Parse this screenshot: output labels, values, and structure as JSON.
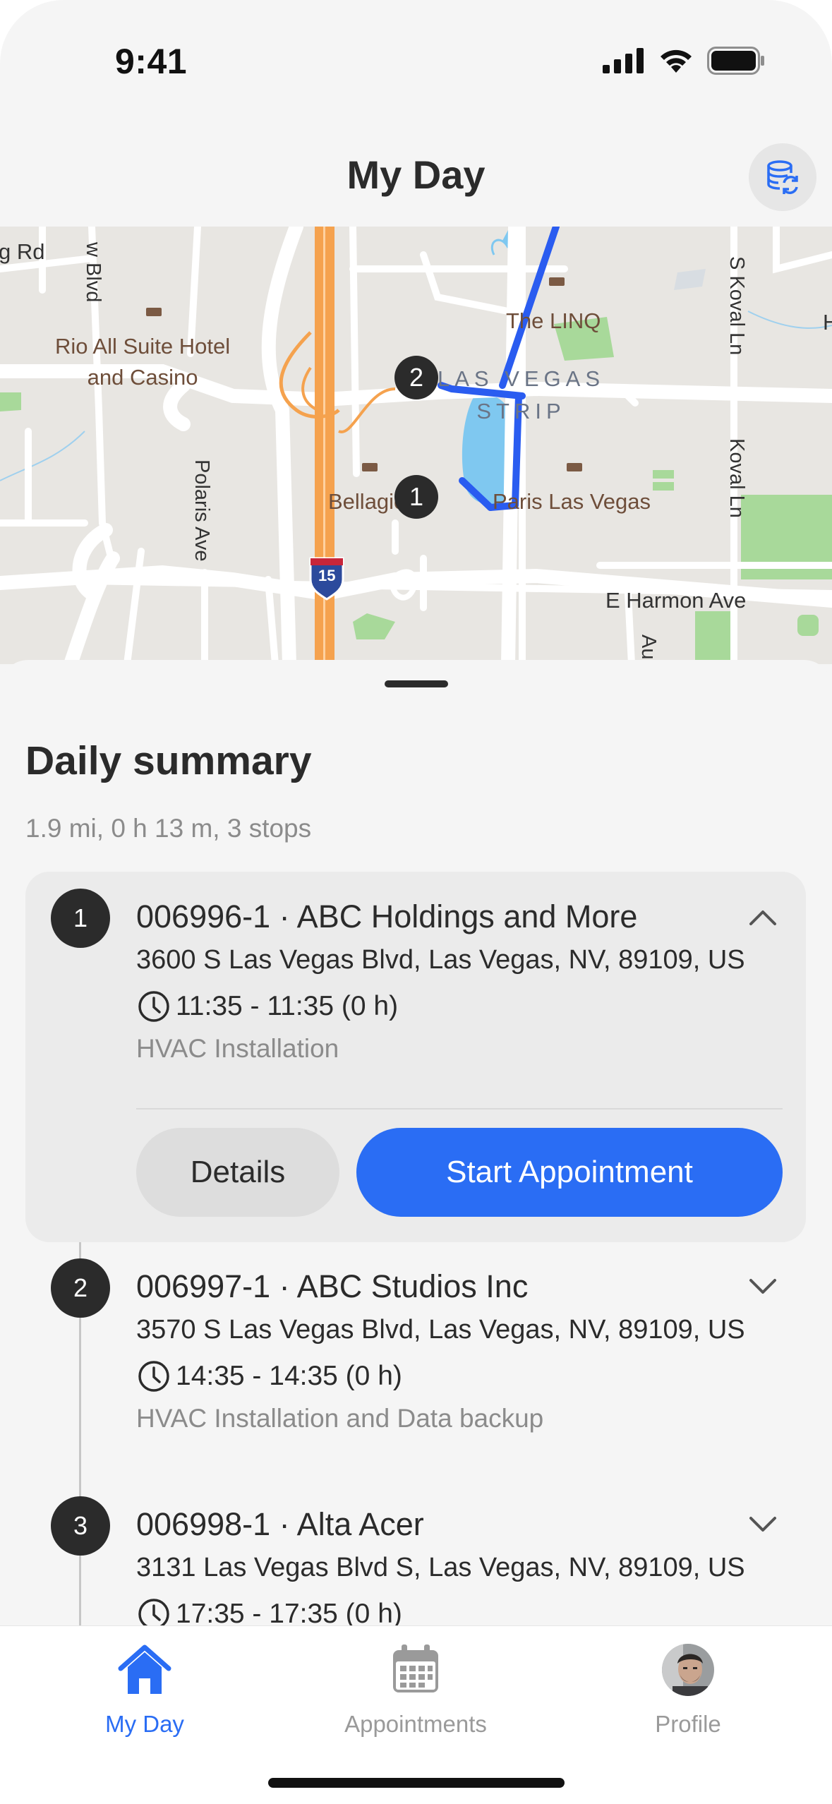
{
  "status_bar": {
    "time": "9:41"
  },
  "header": {
    "title": "My Day",
    "sync_icon": "database-refresh-icon"
  },
  "map": {
    "labels": {
      "road_rd": "g Rd",
      "w_blvd": "w Blvd",
      "rio_line1": "Rio All Suite Hotel",
      "rio_line2": "and Casino",
      "linq": "The LINQ",
      "strip_line1": "LAS VEGAS",
      "strip_line2": "STRIP",
      "bellagio": "Bellagio",
      "paris": "Paris Las Vegas",
      "polaris": "Polaris Ave",
      "koval_top": "S Koval Ln",
      "koval_mid": "Koval Ln",
      "harmon": "E Harmon Ave",
      "au": "Au",
      "edge_h": "H",
      "interstate": "15"
    },
    "pins": [
      "1",
      "2"
    ],
    "colors": {
      "route": "#2a5cf0",
      "freeway": "#f5a24e",
      "water": "#7fc8f0",
      "park": "#a8d99a"
    }
  },
  "summary": {
    "title": "Daily summary",
    "subtitle": "1.9 mi, 0 h 13 m, 3 stops"
  },
  "stops": [
    {
      "number": "1",
      "title": "006996-1 · ABC Holdings and More",
      "address": "3600 S Las Vegas Blvd, Las Vegas, NV, 89109, US",
      "time": "11:35 - 11:35 (0 h)",
      "service": "HVAC Installation",
      "expanded": true,
      "details_label": "Details",
      "start_label": "Start Appointment"
    },
    {
      "number": "2",
      "title": "006997-1 · ABC Studios Inc",
      "address": "3570 S Las Vegas Blvd, Las Vegas, NV, 89109, US",
      "time": "14:35 - 14:35 (0 h)",
      "service": "HVAC Installation and Data backup",
      "expanded": false
    },
    {
      "number": "3",
      "title": "006998-1 · Alta Acer",
      "address": "3131 Las Vegas Blvd S, Las Vegas, NV, 89109, US",
      "time": "17:35 - 17:35 (0 h)",
      "expanded": false
    }
  ],
  "tabs": [
    {
      "label": "My Day",
      "icon": "home-icon",
      "active": true
    },
    {
      "label": "Appointments",
      "icon": "calendar-icon",
      "active": false
    },
    {
      "label": "Profile",
      "icon": "avatar",
      "active": false
    }
  ],
  "colors": {
    "accent": "#2a6df4",
    "text": "#2b2b2b",
    "muted": "#8b8b8b"
  }
}
